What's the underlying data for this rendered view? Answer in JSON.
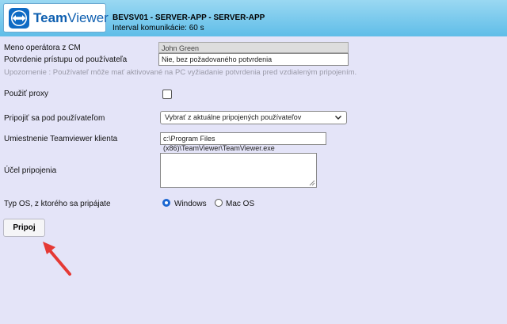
{
  "header": {
    "logo_brand_bold": "Team",
    "logo_brand_light": "Viewer",
    "title": "BEVSV01 - SERVER-APP - SERVER-APP",
    "subtitle": "Interval komunikácie: 60 s"
  },
  "form": {
    "operator_label": "Meno operátora z CM",
    "operator_value": "John Green",
    "confirmation_label": "Potvrdenie prístupu od používateľa",
    "confirmation_value": "Nie, bez požadovaného potvrdenia",
    "warning_text": "Upozornenie : Používateľ môže mať aktivované na PC vyžiadanie potvrdenia pred vzdialeným pripojením.",
    "proxy_label": "Použiť proxy",
    "proxy_checked": false,
    "connect_as_label": "Pripojiť sa pod používateľom",
    "connect_as_value": "Vybrať z aktuálne pripojených používateľov",
    "client_location_label": "Umiestnenie Teamviewer klienta",
    "client_location_value": "c:\\Program Files (x86)\\TeamViewer\\TeamViewer.exe",
    "purpose_label": "Účel pripojenia",
    "purpose_value": "",
    "os_label": "Typ OS, z ktorého sa pripájate",
    "os_options": [
      "Windows",
      "Mac OS"
    ],
    "os_selected": "Windows",
    "connect_button": "Pripoj"
  },
  "colors": {
    "background": "#e4e4f8",
    "header_gradient_top": "#9ad8f2",
    "header_gradient_bottom": "#5fbde8",
    "brand_blue": "#0e5fb0",
    "arrow_red": "#e53935",
    "radio_accent": "#1a66d1"
  },
  "icons": {
    "logo": "teamviewer-logo-icon",
    "dropdown": "chevron-down-icon",
    "annotation": "red-arrow-icon"
  }
}
